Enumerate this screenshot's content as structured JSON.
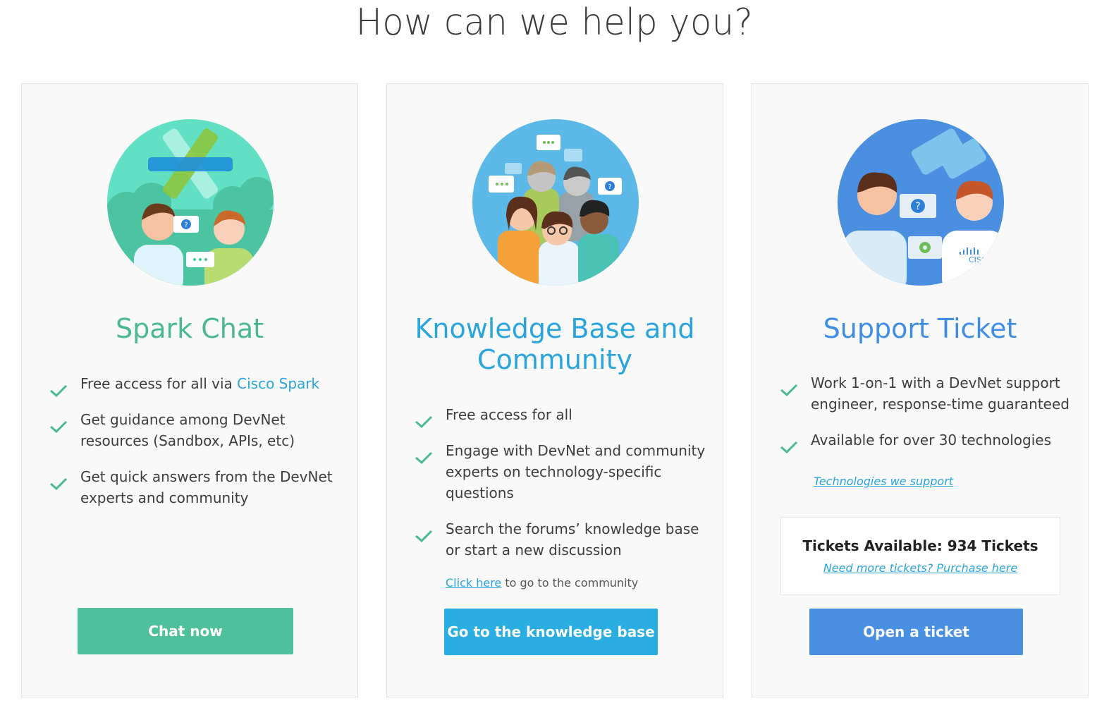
{
  "page": {
    "title": "How can we help you?"
  },
  "cards": [
    {
      "title": "Spark Chat",
      "features": [
        {
          "text": "Free access for all via ",
          "link": "Cisco Spark"
        },
        {
          "text": "Get guidance among DevNet resources (Sandbox, APIs, etc)"
        },
        {
          "text": "Get quick answers from the DevNet experts and community"
        }
      ],
      "button": "Chat now",
      "accent": "#4ab893",
      "illustration": "spark-chat-illustration"
    },
    {
      "title": "Knowledge Base and Community",
      "features": [
        {
          "text": "Free access for all"
        },
        {
          "text": "Engage with DevNet and community experts on technology-specific questions"
        },
        {
          "text": "Search the forums’ knowledge base or start a new discussion"
        }
      ],
      "note_link": "Click here",
      "note_text": " to go to the community",
      "button": "Go to the knowledge base",
      "accent": "#2aa4dc",
      "illustration": "community-illustration"
    },
    {
      "title": "Support Ticket",
      "features": [
        {
          "text": "Work 1-on-1 with a DevNet support engineer, response-time guaranteed"
        },
        {
          "text": "Available for over 30 technologies"
        }
      ],
      "tech_link": "Technologies we support",
      "tickets_label": "Tickets Available: 934 Tickets",
      "purchase_link": "Need more tickets? Purchase here",
      "button": "Open a ticket",
      "accent": "#3f8ee3",
      "illustration": "support-ticket-illustration",
      "logo_text": "CISCO"
    }
  ]
}
